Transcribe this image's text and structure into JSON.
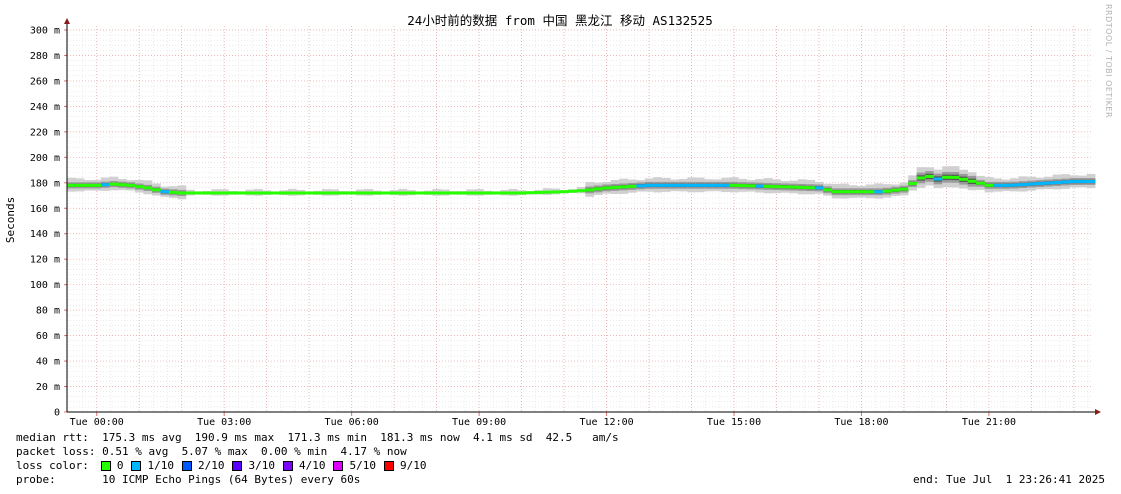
{
  "watermark": "RRDTOOL / TOBI OETIKER",
  "chart_data": {
    "type": "line",
    "title": "24小时前的数据 from 中国 黑龙江 移动 AS132525",
    "ylabel": "Seconds",
    "xlabel": "",
    "ylim": [
      0,
      300
    ],
    "yticks": [
      0,
      20,
      40,
      60,
      80,
      100,
      120,
      140,
      160,
      180,
      200,
      220,
      240,
      260,
      280,
      300
    ],
    "ytick_labels": [
      "0",
      "20 m",
      "40 m",
      "60 m",
      "80 m",
      "100 m",
      "120 m",
      "140 m",
      "160 m",
      "180 m",
      "200 m",
      "220 m",
      "240 m",
      "260 m",
      "280 m",
      "300 m"
    ],
    "xlim_hours": [
      -0.7,
      23.45
    ],
    "xticks_hours": [
      0,
      3,
      6,
      9,
      12,
      15,
      18,
      21
    ],
    "xtick_labels": [
      "Tue 00:00",
      "Tue 03:00",
      "Tue 06:00",
      "Tue 09:00",
      "Tue 12:00",
      "Tue 15:00",
      "Tue 18:00",
      "Tue 21:00"
    ],
    "grid": true,
    "series": [
      {
        "name": "median rtt",
        "x_hours": [
          -0.7,
          -0.3,
          0.0,
          0.4,
          0.8,
          1.2,
          1.6,
          2.0,
          4.0,
          6.0,
          8.0,
          10.0,
          11.0,
          11.5,
          12.0,
          12.5,
          13.0,
          14.0,
          15.0,
          16.0,
          17.0,
          17.4,
          18.0,
          18.5,
          19.0,
          19.5,
          19.8,
          20.1,
          20.5,
          21.0,
          21.5,
          22.0,
          22.5,
          23.0,
          23.45
        ],
        "y_ms": [
          178,
          178,
          178,
          179,
          178,
          176,
          173,
          172,
          172,
          172,
          172,
          172,
          173,
          174,
          176,
          177,
          178,
          178,
          178,
          177,
          176,
          173,
          173,
          173,
          175,
          186,
          183,
          185,
          182,
          178,
          178,
          179,
          180,
          181,
          181
        ]
      }
    ]
  },
  "stats": {
    "median_rtt": "median rtt:  175.3 ms avg  190.9 ms max  171.3 ms min  181.3 ms now  4.1 ms sd  42.5   am/s",
    "packet_loss": "packet loss: 0.51 % avg  5.07 % max  0.00 % min  4.17 % now",
    "loss_label": "loss color:",
    "probe": "probe:       10 ICMP Echo Pings (64 Bytes) every 60s",
    "end": "end: Tue Jul  1 23:26:41 2025"
  },
  "loss_colors": [
    {
      "label": "0",
      "color": "#26ff00"
    },
    {
      "label": "1/10",
      "color": "#00b8ff"
    },
    {
      "label": "2/10",
      "color": "#0059ff"
    },
    {
      "label": "3/10",
      "color": "#5e00ff"
    },
    {
      "label": "4/10",
      "color": "#7e00ff"
    },
    {
      "label": "5/10",
      "color": "#dd00ff"
    },
    {
      "label": "9/10",
      "color": "#ff0000"
    }
  ]
}
